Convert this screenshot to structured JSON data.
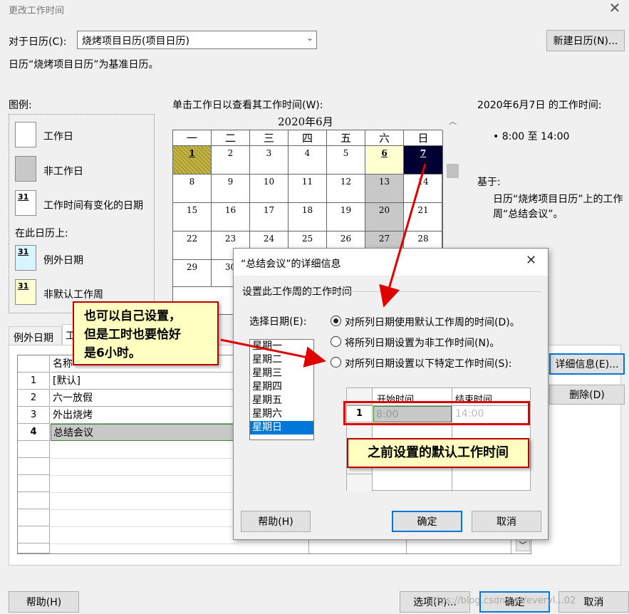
{
  "window": {
    "title": "更改工作时间"
  },
  "for_calendar_label": "对于日历(C):",
  "calendar_select_value": "烧烤项目日历(项目日历)",
  "new_calendar_button": "新建日历(N)...",
  "base_calendar_note": "日历“烧烤项目日历”为基准日历。",
  "legend": {
    "title": "图例:",
    "items": [
      {
        "label": "工作日"
      },
      {
        "label": "非工作日"
      },
      {
        "label": "工作时间有变化的日期",
        "num": "31"
      }
    ],
    "on_this_calendar": "在此日历上:",
    "items2": [
      {
        "label": "例外日期",
        "num": "31"
      },
      {
        "label": "非默认工作周",
        "num": "31"
      }
    ]
  },
  "calendar": {
    "instruction": "单击工作日以查看其工作时间(W):",
    "month": "2020年6月",
    "weekdays": [
      "一",
      "二",
      "三",
      "四",
      "五",
      "六",
      "日"
    ],
    "weeks": [
      [
        "1",
        "2",
        "3",
        "4",
        "5",
        "6",
        "7"
      ],
      [
        "8",
        "9",
        "10",
        "11",
        "12",
        "13",
        "14"
      ],
      [
        "15",
        "16",
        "17",
        "18",
        "19",
        "20",
        "21"
      ],
      [
        "22",
        "23",
        "24",
        "25",
        "26",
        "27",
        "28"
      ],
      [
        "29",
        "30",
        "",
        "",
        "",
        "",
        ""
      ]
    ]
  },
  "working_time": {
    "header": "2020年6月7日 的工作时间:",
    "range": "• 8:00 至 14:00",
    "based_on_label": "基于:",
    "based_on_line1": "日历“烧烤项目日历”上的工作",
    "based_on_line2": "周“总结会议”。"
  },
  "tabs": {
    "exceptions": "例外日期",
    "work_weeks": "工"
  },
  "table": {
    "col_name": "名称",
    "rows": [
      {
        "num": "1",
        "name": "[默认]"
      },
      {
        "num": "2",
        "name": "六一放假"
      },
      {
        "num": "3",
        "name": "外出烧烤"
      },
      {
        "num": "4",
        "name": "总结会议"
      }
    ]
  },
  "side_buttons": {
    "details": "详细信息(E)...",
    "delete": "删除(D)"
  },
  "bottom_buttons": {
    "help": "帮助(H)",
    "options": "选项(P)...",
    "ok": "确定",
    "cancel": "取消"
  },
  "watermark": "https://blog.csdn.net/everyl...02",
  "dialog": {
    "title": "“总结会议”的详细信息",
    "section_label": "设置此工作周的工作时间",
    "select_days_label": "选择日期(E):",
    "days": [
      "星期一",
      "星期二",
      "星期三",
      "星期四",
      "星期五",
      "星期六",
      "星期日"
    ],
    "options": [
      "对所列日期使用默认工作周的时间(D)。",
      "将所列日期设置为非工作时间(N)。",
      "对所列日期设置以下特定工作时间(S):"
    ],
    "grid": {
      "col_start": "开始时间",
      "col_end": "结束时间",
      "row_num": "1",
      "start": "8:00",
      "end": "14:00"
    },
    "help_button": "帮助(H)",
    "ok_button": "确定",
    "cancel_button": "取消"
  },
  "annotations": {
    "callout_left_line1": "也可以自己设置，",
    "callout_left_line2": "但是工时也要恰好",
    "callout_left_line3": "是6小时。",
    "callout_right": "之前设置的默认工作时间"
  },
  "colors": {
    "accent": "#0078d7",
    "annotation_red": "#c00000",
    "annotation_fill": "#ffffc0",
    "nonwork_gray": "#c8c8c8",
    "selected_day": "#000033",
    "nondefault_week": "#ffffd0",
    "exception_cyan": "#d8f4ff"
  }
}
